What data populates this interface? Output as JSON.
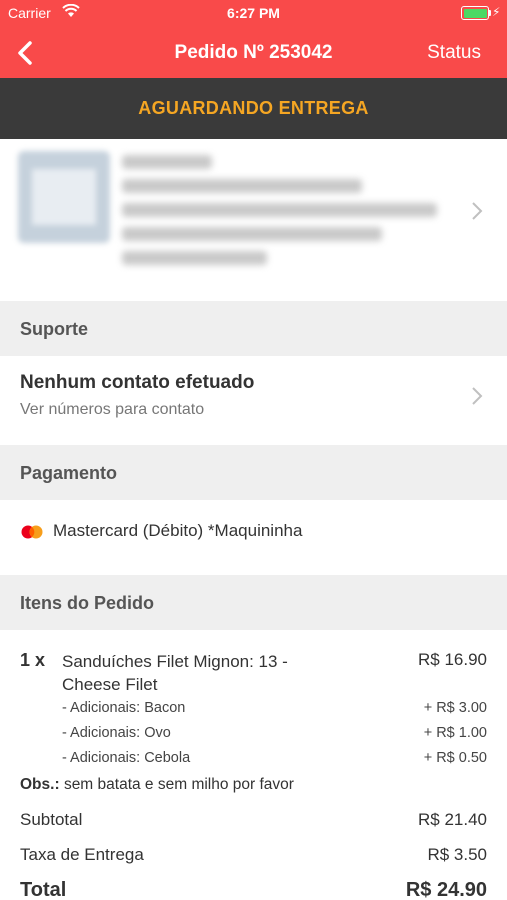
{
  "status_bar": {
    "carrier": "Carrier",
    "time": "6:27 PM"
  },
  "nav": {
    "title": "Pedido Nº 253042",
    "status_label": "Status",
    "back_icon": "chevron-left-icon"
  },
  "banner": {
    "text": "AGUARDANDO ENTREGA",
    "color": "#f5a623"
  },
  "colors": {
    "header_bg": "#f94a4a",
    "banner_bg": "#3a3a3a",
    "section_bg": "#efefef"
  },
  "sections": {
    "support": "Suporte",
    "payment": "Pagamento",
    "items": "Itens do Pedido"
  },
  "support": {
    "title": "Nenhum contato efetuado",
    "subtitle": "Ver números para contato"
  },
  "payment": {
    "icon": "mastercard-icon",
    "method": "Mastercard (Débito) *Maquininha"
  },
  "order": {
    "items": [
      {
        "qty": "1 x",
        "name": "Sanduíches Filet Mignon: 13 - Cheese Filet",
        "price": "R$ 16.90",
        "addons": [
          {
            "label": "- Adicionais: Bacon",
            "price": "+ R$ 3.00"
          },
          {
            "label": "- Adicionais: Ovo",
            "price": "+ R$ 1.00"
          },
          {
            "label": "- Adicionais: Cebola",
            "price": "+ R$ 0.50"
          }
        ]
      }
    ],
    "obs_label": "Obs.:",
    "obs_text": "sem batata e sem milho por favor",
    "subtotal_label": "Subtotal",
    "subtotal_value": "R$ 21.40",
    "delivery_label": "Taxa de Entrega",
    "delivery_value": "R$ 3.50",
    "total_label": "Total",
    "total_value": "R$ 24.90"
  }
}
